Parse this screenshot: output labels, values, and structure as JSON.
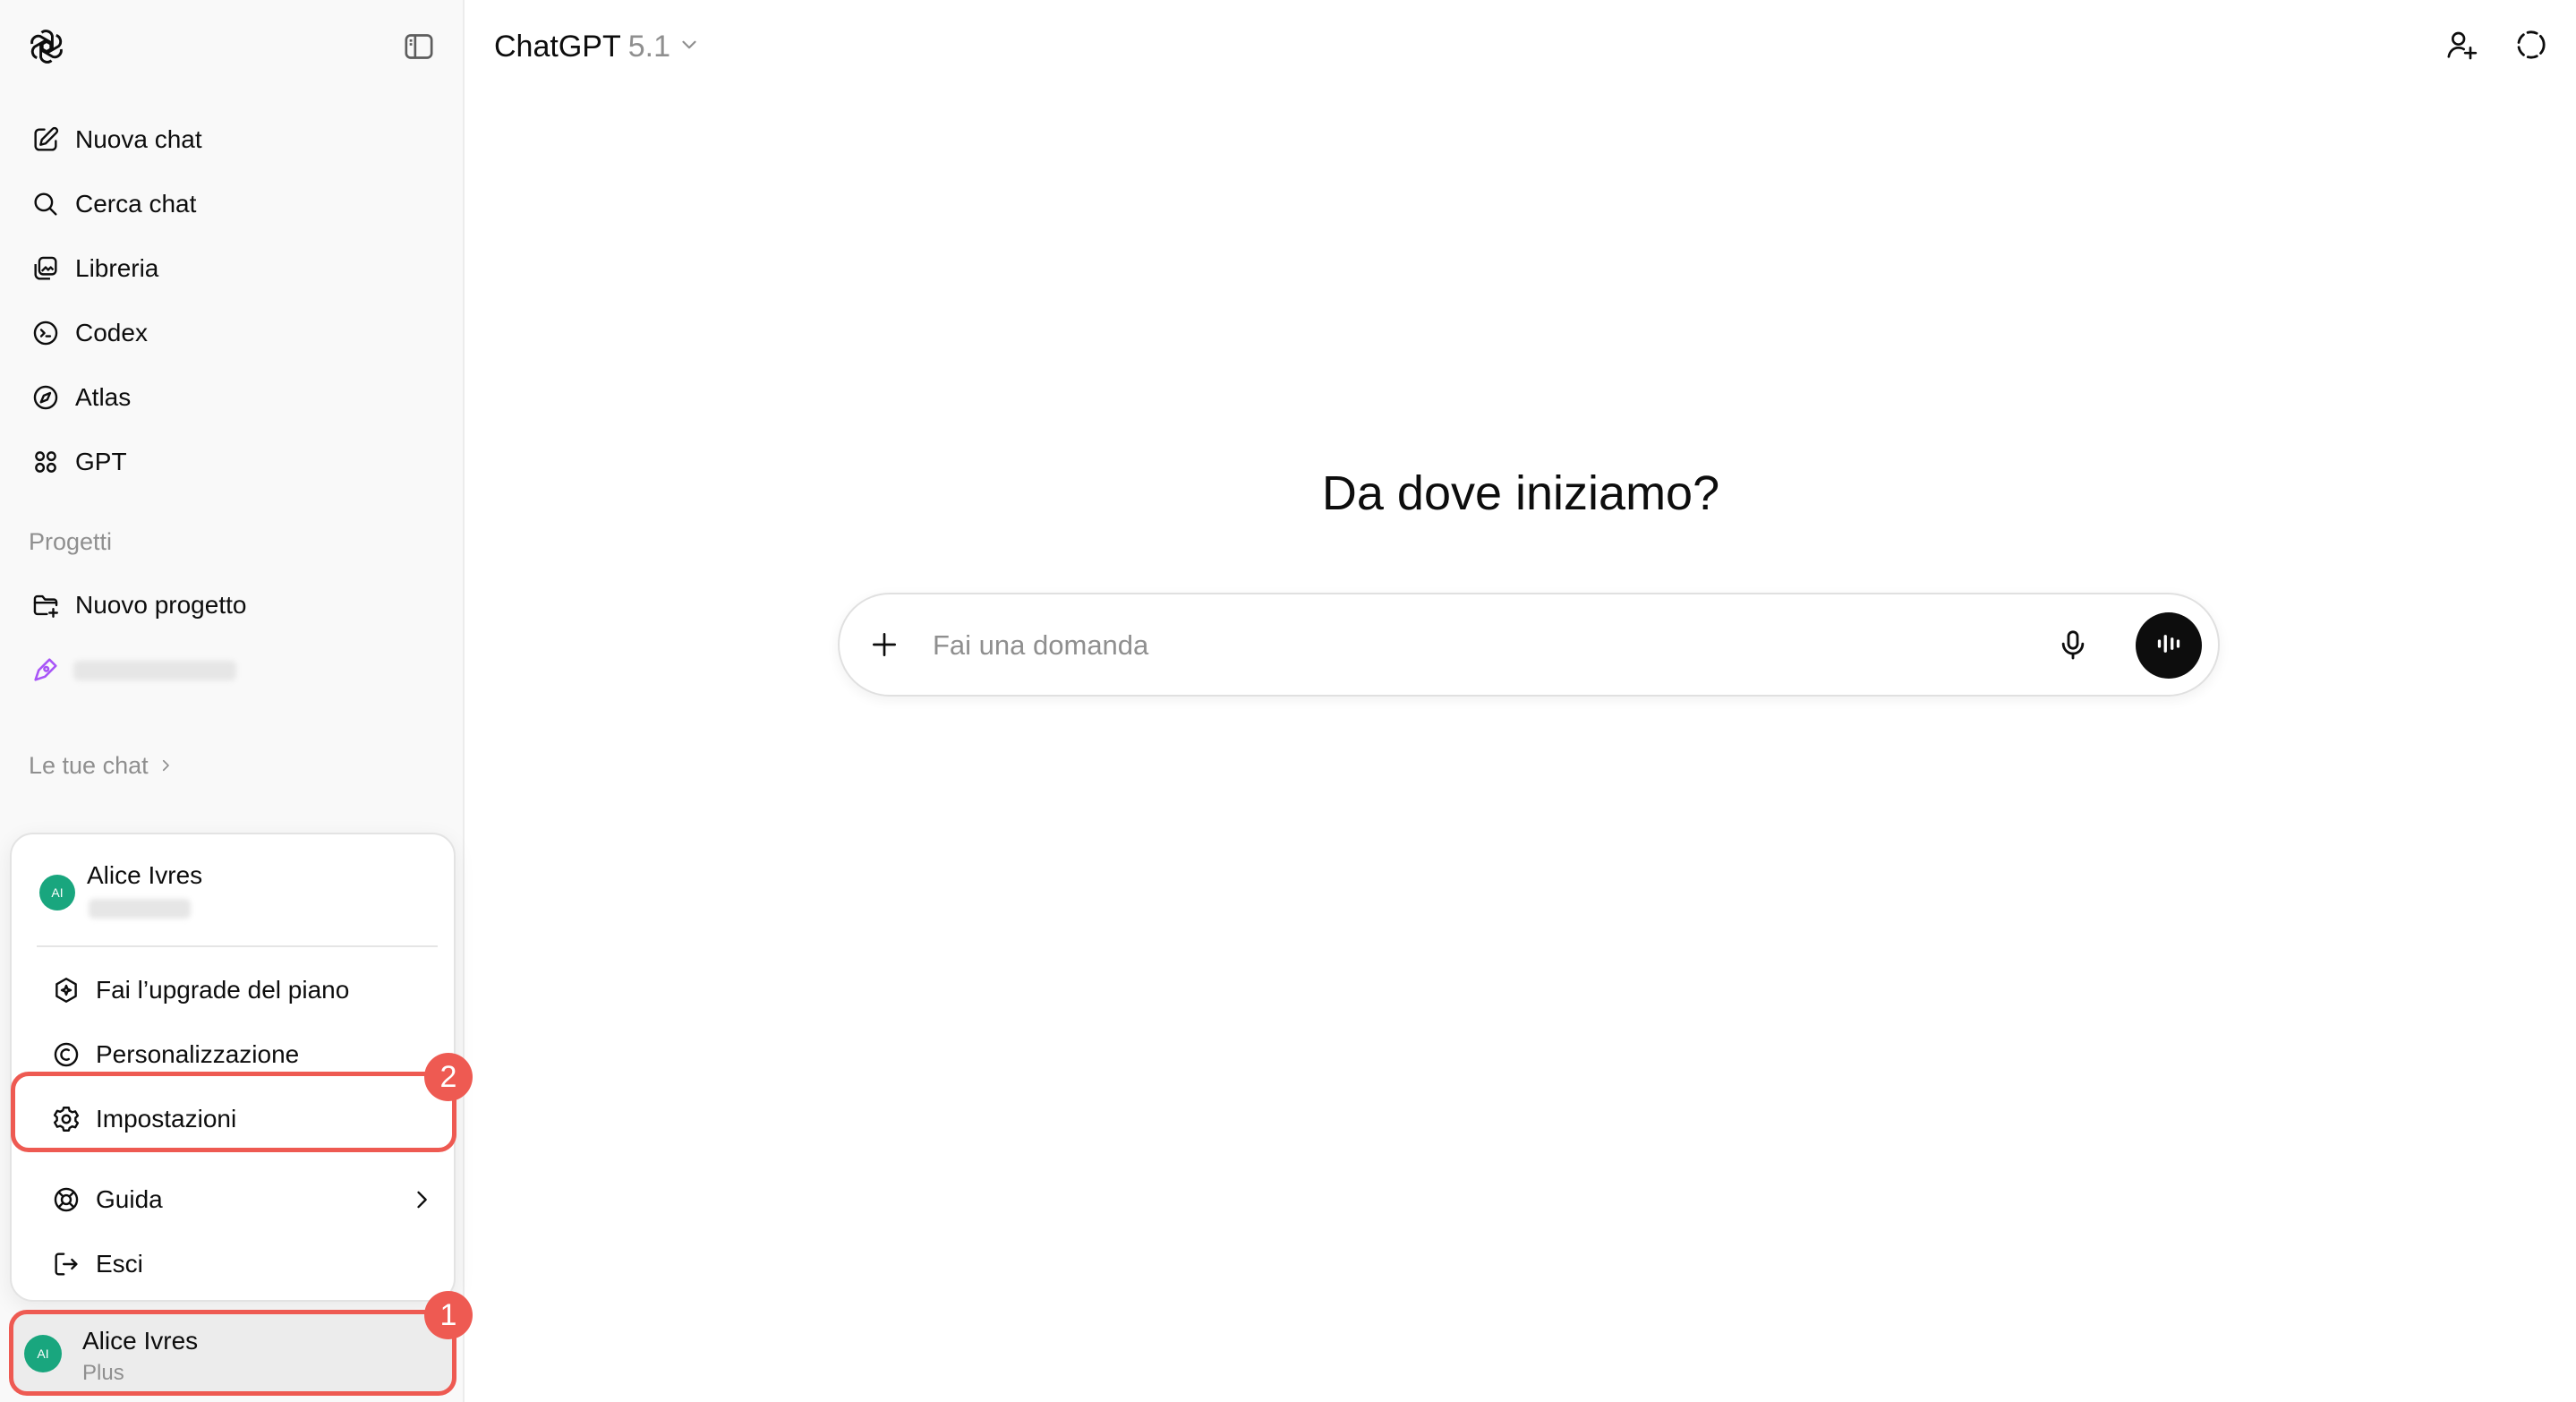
{
  "sidebar": {
    "nav": [
      {
        "label": "Nuova chat",
        "icon": "new-chat-icon"
      },
      {
        "label": "Cerca chat",
        "icon": "search-icon"
      },
      {
        "label": "Libreria",
        "icon": "library-icon"
      },
      {
        "label": "Codex",
        "icon": "codex-icon"
      },
      {
        "label": "Atlas",
        "icon": "atlas-icon"
      },
      {
        "label": "GPT",
        "icon": "grid-icon"
      }
    ],
    "projects_label": "Progetti",
    "new_project_label": "Nuovo progetto",
    "your_chats_label": "Le tue chat"
  },
  "account_menu": {
    "user_name": "Alice Ivres",
    "avatar_initials": "AI",
    "items": [
      {
        "label": "Fai l’upgrade del piano",
        "icon": "upgrade-icon"
      },
      {
        "label": "Personalizzazione",
        "icon": "personalization-icon"
      },
      {
        "label": "Impostazioni",
        "icon": "gear-icon"
      },
      {
        "label": "Guida",
        "icon": "help-icon"
      },
      {
        "label": "Esci",
        "icon": "logout-icon"
      }
    ]
  },
  "profile": {
    "name": "Alice Ivres",
    "plan": "Plus",
    "avatar_initials": "AI"
  },
  "annotations": [
    "1",
    "2"
  ],
  "header": {
    "model_name": "ChatGPT",
    "model_version": "5.1"
  },
  "main": {
    "heading": "Da dove iniziamo?",
    "composer_placeholder": "Fai una domanda"
  },
  "colors": {
    "accent_highlight": "#ee5a52",
    "avatar": "#19a67e",
    "sidebar_bg": "#f9f9f9",
    "project_icon": "#a855f7"
  }
}
